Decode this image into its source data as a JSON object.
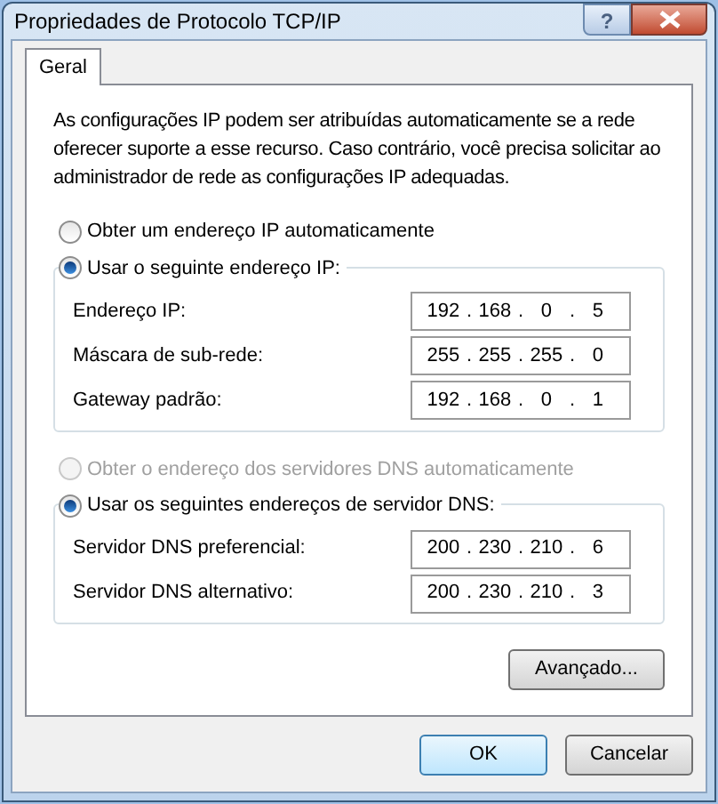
{
  "window": {
    "title": "Propriedades de Protocolo TCP/IP",
    "help_button": "?"
  },
  "tabs": [
    {
      "label": "Geral",
      "selected": true
    }
  ],
  "description": "As configurações IP podem ser atribuídas automaticamente se a rede oferecer suporte a esse recurso. Caso contrário, você precisa solicitar ao administrador de rede as configurações IP adequadas.",
  "radio_groups": [
    {
      "options": [
        {
          "label": "Obter um endereço IP automaticamente",
          "selected": false,
          "disabled": false
        },
        {
          "label": "Usar o seguinte endereço IP:",
          "selected": true,
          "disabled": false,
          "fields": [
            {
              "label": "Endereço IP:",
              "octets": [
                "192",
                "168",
                "0",
                "5"
              ]
            },
            {
              "label": "Máscara de sub-rede:",
              "octets": [
                "255",
                "255",
                "255",
                "0"
              ]
            },
            {
              "label": "Gateway padrão:",
              "octets": [
                "192",
                "168",
                "0",
                "1"
              ]
            }
          ]
        }
      ]
    },
    {
      "options": [
        {
          "label": "Obter o endereço dos servidores DNS automaticamente",
          "selected": false,
          "disabled": true
        },
        {
          "label": "Usar os seguintes endereços de servidor DNS:",
          "selected": true,
          "disabled": false,
          "fields": [
            {
              "label": "Servidor DNS preferencial:",
              "octets": [
                "200",
                "230",
                "210",
                "6"
              ]
            },
            {
              "label": "Servidor DNS alternativo:",
              "octets": [
                "200",
                "230",
                "210",
                "3"
              ]
            }
          ]
        }
      ]
    }
  ],
  "ip_separator": ".",
  "advanced_button": "Avançado...",
  "buttons": [
    {
      "label": "OK",
      "default": true
    },
    {
      "label": "Cancelar",
      "default": false
    }
  ]
}
